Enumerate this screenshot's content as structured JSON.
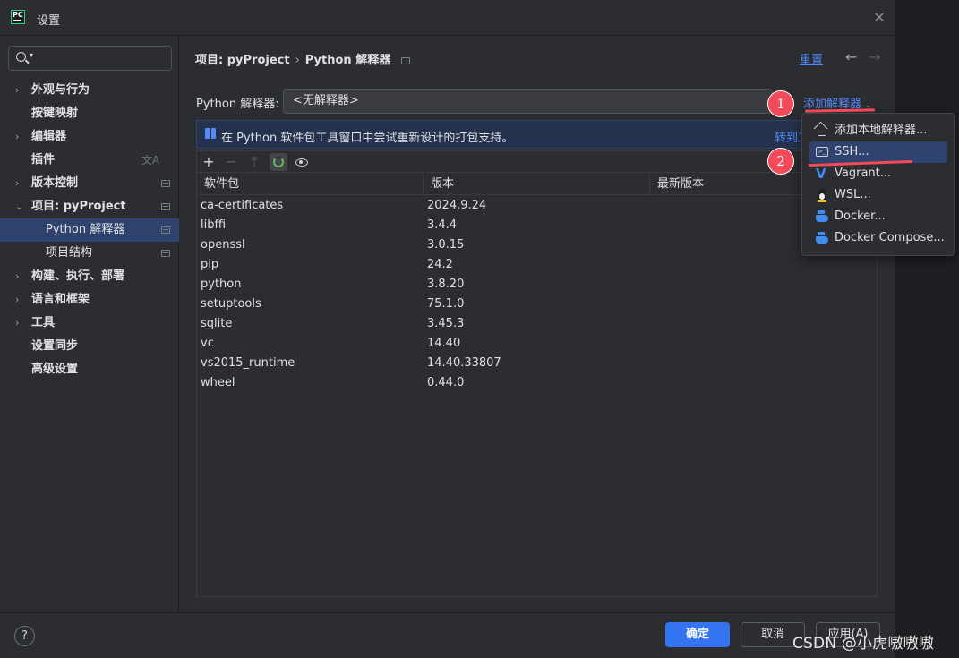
{
  "window": {
    "title": "设置",
    "app_icon_text": "PC"
  },
  "sidebar": {
    "search_placeholder": "",
    "items": [
      {
        "label": "外观与行为",
        "expandable": true
      },
      {
        "label": "按键映射",
        "expandable": false
      },
      {
        "label": "编辑器",
        "expandable": true
      },
      {
        "label": "插件",
        "expandable": false,
        "trailing_icon": "translate-icon"
      },
      {
        "label": "版本控制",
        "expandable": true,
        "marker": true
      },
      {
        "label": "项目: pyProject",
        "expandable": true,
        "expanded": true,
        "marker": true
      },
      {
        "label": "Python 解释器",
        "sub": true,
        "selected": true,
        "marker": true
      },
      {
        "label": "项目结构",
        "sub": true,
        "marker": true
      },
      {
        "label": "构建、执行、部署",
        "expandable": true
      },
      {
        "label": "语言和框架",
        "expandable": true
      },
      {
        "label": "工具",
        "expandable": true
      },
      {
        "label": "设置同步",
        "expandable": false
      },
      {
        "label": "高级设置",
        "expandable": false
      }
    ]
  },
  "header": {
    "crumb_parent": "项目: pyProject",
    "crumb_current": "Python 解释器",
    "reset_label": "重置"
  },
  "interpreter": {
    "label": "Python 解释器:",
    "value": "<无解释器>",
    "add_label": "添加解释器"
  },
  "banner": {
    "text": "在 Python 软件包工具窗口中尝试重新设计的打包支持。",
    "link": "转到工"
  },
  "table": {
    "columns": [
      "软件包",
      "版本",
      "最新版本"
    ],
    "rows": [
      {
        "name": "ca-certificates",
        "version": "2024.9.24",
        "latest": ""
      },
      {
        "name": "libffi",
        "version": "3.4.4",
        "latest": ""
      },
      {
        "name": "openssl",
        "version": "3.0.15",
        "latest": ""
      },
      {
        "name": "pip",
        "version": "24.2",
        "latest": ""
      },
      {
        "name": "python",
        "version": "3.8.20",
        "latest": ""
      },
      {
        "name": "setuptools",
        "version": "75.1.0",
        "latest": ""
      },
      {
        "name": "sqlite",
        "version": "3.45.3",
        "latest": ""
      },
      {
        "name": "vc",
        "version": "14.40",
        "latest": ""
      },
      {
        "name": "vs2015_runtime",
        "version": "14.40.33807",
        "latest": ""
      },
      {
        "name": "wheel",
        "version": "0.44.0",
        "latest": ""
      }
    ]
  },
  "popup": {
    "items": [
      {
        "label": "添加本地解释器...",
        "icon": "home-icon"
      },
      {
        "label": "SSH...",
        "icon": "terminal-icon",
        "selected": true
      },
      {
        "label": "Vagrant...",
        "icon": "vagrant-icon"
      },
      {
        "label": "WSL...",
        "icon": "linux-icon"
      },
      {
        "label": "Docker...",
        "icon": "docker-icon"
      },
      {
        "label": "Docker Compose...",
        "icon": "docker-icon"
      }
    ]
  },
  "annotations": {
    "step1": "1",
    "step2": "2",
    "color": "#f24a58"
  },
  "footer": {
    "help": "?",
    "ok": "确定",
    "cancel": "取消",
    "apply": "应用(A)"
  },
  "watermark": "CSDN @小虎嗷嗷嗷",
  "colors": {
    "accent": "#3574f0",
    "link": "#548af7",
    "selection": "#2e436e",
    "background": "#2b2d30"
  }
}
